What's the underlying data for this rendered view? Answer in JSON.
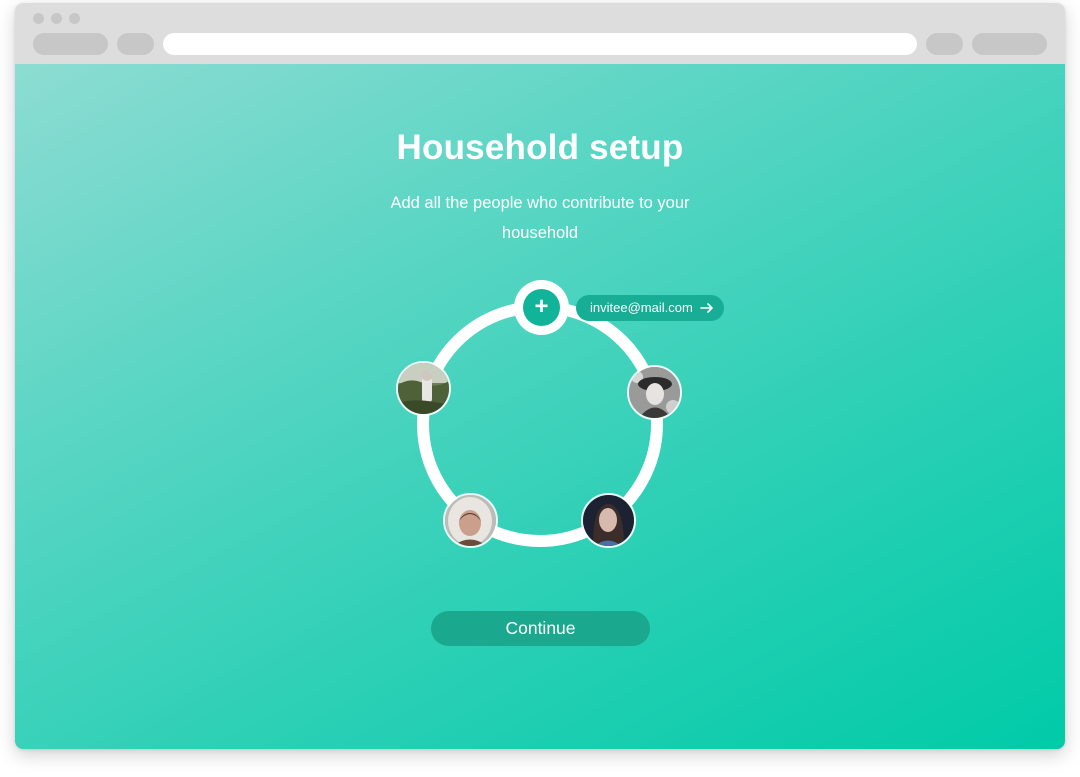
{
  "page": {
    "title": "Household setup",
    "subtitle": "Add all the people who contribute to your household"
  },
  "invite": {
    "email": "invitee@mail.com",
    "add_icon": "plus-icon",
    "submit_icon": "arrow-right-icon"
  },
  "members": [
    {
      "name": "member-1"
    },
    {
      "name": "member-2"
    },
    {
      "name": "member-3"
    },
    {
      "name": "member-4"
    }
  ],
  "actions": {
    "continue_label": "Continue"
  },
  "colors": {
    "accent": "#12b499",
    "button": "#1aa88e",
    "gradient_start": "#8ddcd2",
    "gradient_end": "#00cba8"
  }
}
